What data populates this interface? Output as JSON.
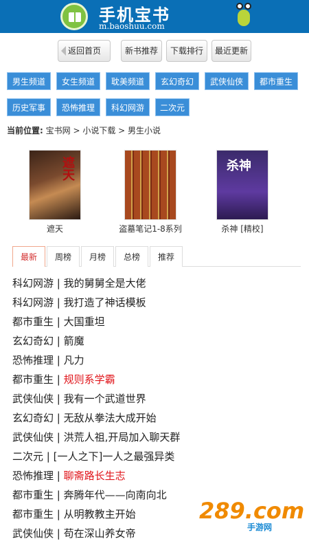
{
  "header": {
    "title": "手机宝书",
    "url": "m.baoshuu.com"
  },
  "topnav": {
    "back": "返回首页",
    "items": [
      "新书推荐",
      "下载排行",
      "最近更新"
    ]
  },
  "categories": [
    "男生频道",
    "女生频道",
    "耽美频道",
    "玄幻奇幻",
    "武侠仙侠",
    "都市重生",
    "历史军事",
    "恐怖推理",
    "科幻网游",
    "二次元"
  ],
  "breadcrumb": {
    "label": "当前位置:",
    "path": "宝书网 > 小说下载 > 男生小说"
  },
  "books": [
    {
      "title": "遮天",
      "cover_text": "遮天"
    },
    {
      "title": "盗墓笔记1-8系列",
      "cover_text": ""
    },
    {
      "title": "杀神 [精校]",
      "cover_text": "杀神"
    }
  ],
  "tabs": [
    "最新",
    "周榜",
    "月榜",
    "总榜",
    "推荐"
  ],
  "list": [
    {
      "cat": "科幻网游",
      "title": "我的舅舅全是大佬",
      "red": false
    },
    {
      "cat": "科幻网游",
      "title": "我打造了神话模板",
      "red": false
    },
    {
      "cat": "都市重生",
      "title": "大国重坦",
      "red": false
    },
    {
      "cat": "玄幻奇幻",
      "title": "箭魔",
      "red": false
    },
    {
      "cat": "恐怖推理",
      "title": "凡力",
      "red": false
    },
    {
      "cat": "都市重生",
      "title": "规则系学霸",
      "red": true
    },
    {
      "cat": "武侠仙侠",
      "title": "我有一个武道世界",
      "red": false
    },
    {
      "cat": "玄幻奇幻",
      "title": "无敌从拳法大成开始",
      "red": false
    },
    {
      "cat": "武侠仙侠",
      "title": "洪荒人祖,开局加入聊天群",
      "red": false
    },
    {
      "cat": "二次元",
      "title": "[一人之下]一人之最强异类",
      "red": false
    },
    {
      "cat": "恐怖推理",
      "title": "聊斋路长生志",
      "red": true
    },
    {
      "cat": "都市重生",
      "title": "奔腾年代——向南向北",
      "red": false
    },
    {
      "cat": "都市重生",
      "title": "从明教教主开始",
      "red": false
    },
    {
      "cat": "武侠仙侠",
      "title": "苟在深山养女帝",
      "red": false
    }
  ],
  "watermark": {
    "big": "289.com",
    "small": "手游网"
  }
}
